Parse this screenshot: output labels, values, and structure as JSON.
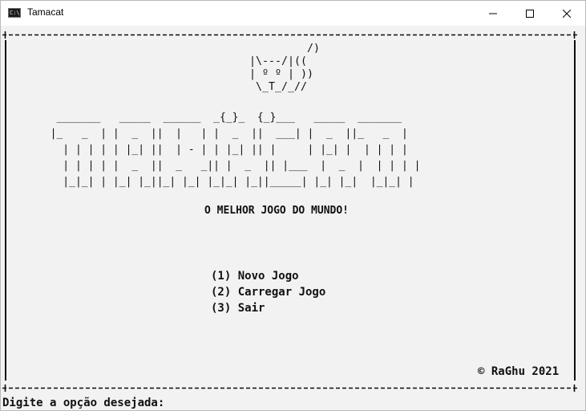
{
  "window": {
    "title": "Tamacat",
    "icon": "console-app-icon",
    "icon_text": "C:\\."
  },
  "art": {
    "cat": "         /)\n|\\---/|((\n| º º | ))\n \\_T_/_//",
    "logo": "   _______   _____  ______  _{_}_  {_}___   _____  _______\n  |_   _  | |  _  ||  |   | |  _  ||  ___| |  _  ||_   _  |\n    | | | | | |_| ||  | - | | |_| || |     | |_| |  | | | |\n    | | | | |  _  ||  _   _|| |  _  || |___  |  _  |  | | | |\n    |_|_| | |_| |_||_| |_| |_|_| |_||_____| |_| |_|  |_|_| |"
  },
  "subtitle": "O MELHOR JOGO DO MUNDO!",
  "menu": {
    "items": [
      {
        "label": "(1) Novo Jogo"
      },
      {
        "label": "(2) Carregar Jogo"
      },
      {
        "label": "(3) Sair"
      }
    ]
  },
  "footer": {
    "copyright": "© RaGhu 2021"
  },
  "prompt": {
    "text": "Digite a opção desejada:"
  },
  "colors": {
    "background": "#f2f2f2",
    "text": "#101010",
    "titlebar": "#ffffff"
  }
}
